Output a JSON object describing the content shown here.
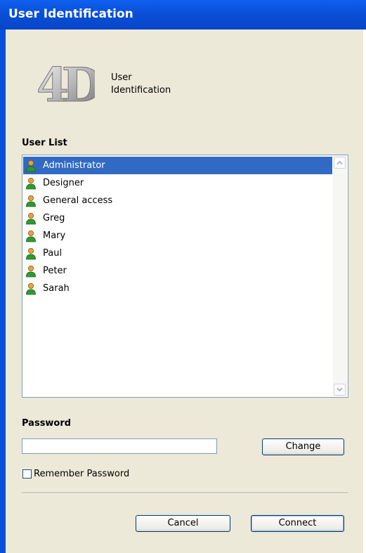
{
  "window": {
    "title": "User Identification"
  },
  "header": {
    "logo_text": "4D",
    "caption_line1": "User",
    "caption_line2": "Identification"
  },
  "user_list": {
    "label": "User List",
    "selected_index": 0,
    "items": [
      {
        "label": "Administrator"
      },
      {
        "label": "Designer"
      },
      {
        "label": "General access"
      },
      {
        "label": "Greg"
      },
      {
        "label": "Mary"
      },
      {
        "label": "Paul"
      },
      {
        "label": "Peter"
      },
      {
        "label": "Sarah"
      }
    ]
  },
  "password": {
    "label": "Password",
    "value": "",
    "change_label": "Change"
  },
  "remember": {
    "label": "Remember Password",
    "checked": false
  },
  "buttons": {
    "cancel": "Cancel",
    "connect": "Connect"
  },
  "colors": {
    "titlebar": "#0a4fd8",
    "selection": "#316ac5",
    "dialog_bg": "#ece9d8"
  }
}
